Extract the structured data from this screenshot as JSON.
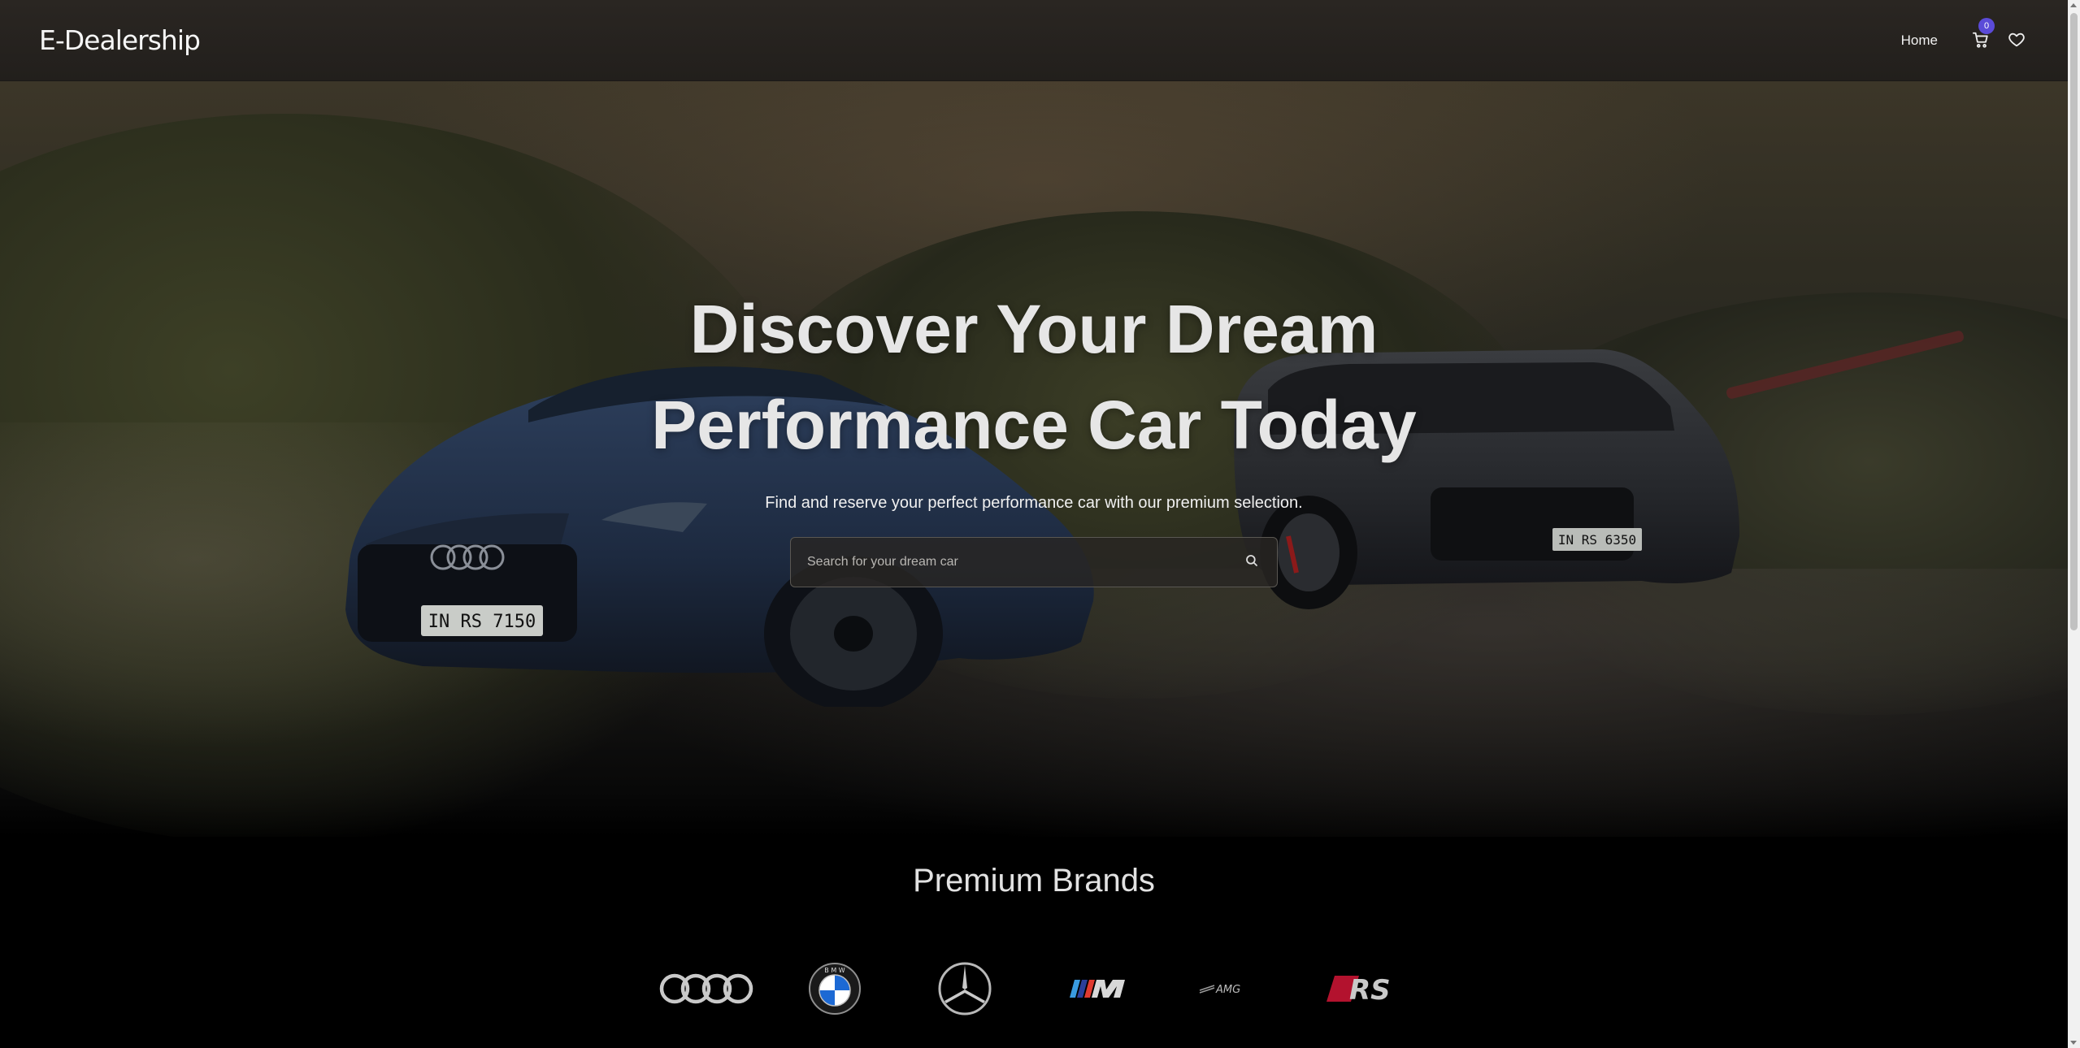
{
  "header": {
    "logo": "E-Dealership",
    "nav": {
      "home": "Home"
    },
    "cart_icon": "cart-icon",
    "cart_count": "0",
    "wishlist_icon": "heart-icon"
  },
  "hero": {
    "title": "Discover Your Dream Performance Car Today",
    "subtitle": "Find and reserve your perfect performance car with our premium selection.",
    "search": {
      "placeholder": "Search for your dream car",
      "value": "",
      "icon": "search-icon"
    },
    "plates": [
      "IN RS 7150",
      "IN RS 6350"
    ]
  },
  "brands": {
    "title": "Premium Brands",
    "items": [
      "Audi",
      "BMW",
      "Mercedes-Benz",
      "M",
      "AMG",
      "RS"
    ],
    "amg_text": "AMG",
    "rs_text": "RS",
    "bmw_text": "B M W"
  },
  "colors": {
    "badge": "#5b4bd8",
    "header_bg": "#252220",
    "bmw_blue": "#1c69d4",
    "rs_red": "#b3122e"
  }
}
